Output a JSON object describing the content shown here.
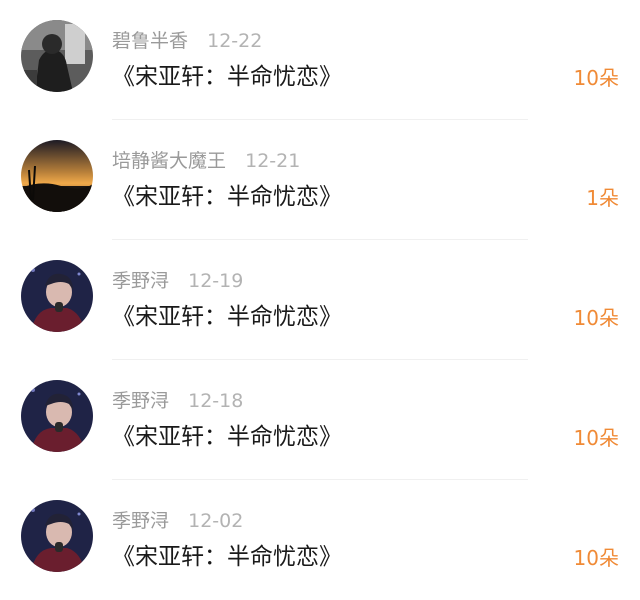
{
  "items": [
    {
      "username": "碧鲁半香",
      "date": "12-22",
      "title": "《宋亚轩：半命忧恋》",
      "gift": "10朵",
      "avatar_icon": "person-portrait-dark-icon"
    },
    {
      "username": "培静酱大魔王",
      "date": "12-21",
      "title": "《宋亚轩：半命忧恋》",
      "gift": "1朵",
      "avatar_icon": "sunset-landscape-icon"
    },
    {
      "username": "季野浔",
      "date": "12-19",
      "title": "《宋亚轩：半命忧恋》",
      "gift": "10朵",
      "avatar_icon": "singer-microphone-icon"
    },
    {
      "username": "季野浔",
      "date": "12-18",
      "title": "《宋亚轩：半命忧恋》",
      "gift": "10朵",
      "avatar_icon": "singer-microphone-icon"
    },
    {
      "username": "季野浔",
      "date": "12-02",
      "title": "《宋亚轩：半命忧恋》",
      "gift": "10朵",
      "avatar_icon": "singer-microphone-icon"
    }
  ],
  "colors": {
    "gift_accent": "#f08a36",
    "username": "#9a9a9a",
    "date": "#b3b3b3",
    "title": "#1a1a1a",
    "divider": "#f0f0f0"
  }
}
